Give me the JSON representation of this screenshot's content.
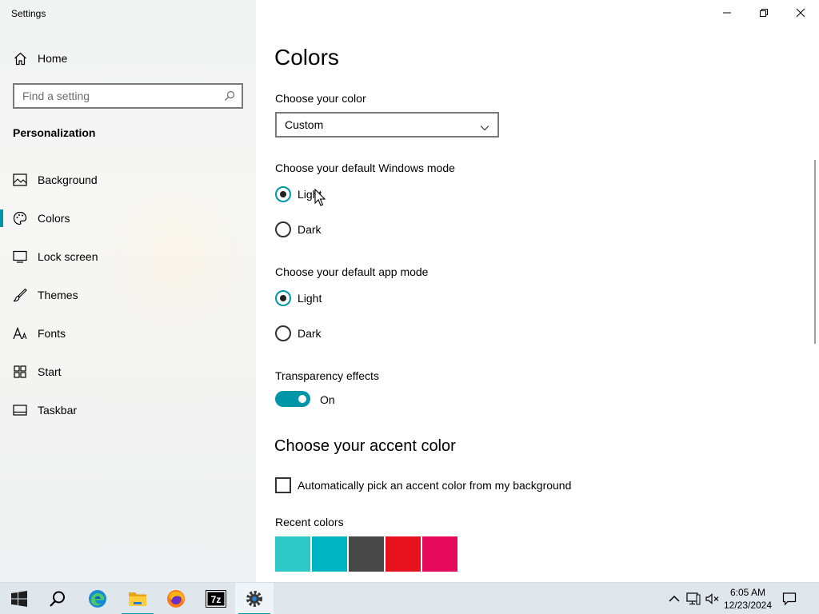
{
  "window": {
    "title": "Settings"
  },
  "sidebar": {
    "home_label": "Home",
    "search_placeholder": "Find a setting",
    "section_title": "Personalization",
    "items": [
      {
        "label": "Background",
        "icon": "picture-icon"
      },
      {
        "label": "Colors",
        "icon": "palette-icon",
        "active": true
      },
      {
        "label": "Lock screen",
        "icon": "lock-screen-icon"
      },
      {
        "label": "Themes",
        "icon": "brush-icon"
      },
      {
        "label": "Fonts",
        "icon": "font-icon"
      },
      {
        "label": "Start",
        "icon": "start-grid-icon"
      },
      {
        "label": "Taskbar",
        "icon": "taskbar-icon"
      }
    ]
  },
  "main": {
    "title": "Colors",
    "color_choice": {
      "label": "Choose your color",
      "value": "Custom"
    },
    "windows_mode": {
      "label": "Choose your default Windows mode",
      "options": [
        "Light",
        "Dark"
      ],
      "selected": "Light"
    },
    "app_mode": {
      "label": "Choose your default app mode",
      "options": [
        "Light",
        "Dark"
      ],
      "selected": "Light"
    },
    "transparency": {
      "label": "Transparency effects",
      "state": "On"
    },
    "accent": {
      "title": "Choose your accent color",
      "auto_pick_label": "Automatically pick an accent color from my background",
      "auto_pick_checked": false,
      "recent_label": "Recent colors",
      "recent_colors": [
        "#2ec8c8",
        "#00b4c4",
        "#474747",
        "#e6121f",
        "#e6085a"
      ]
    }
  },
  "taskbar": {
    "apps": [
      "windows-start-icon",
      "search-icon",
      "edge-icon",
      "file-explorer-icon",
      "firefox-icon",
      "7zip-icon",
      "settings-icon"
    ],
    "clock": {
      "time": "6:05 AM",
      "date": "12/23/2024"
    }
  },
  "colors": {
    "accent": "#0096a8"
  }
}
